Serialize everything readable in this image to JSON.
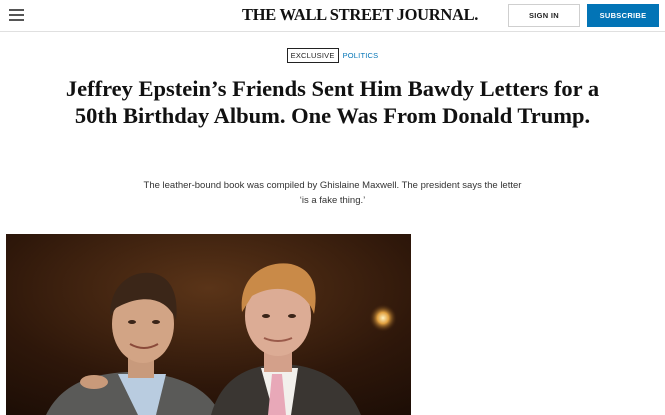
{
  "header": {
    "masthead": "THE WALL STREET JOURNAL.",
    "signin_label": "SIGN IN",
    "subscribe_label": "SUBSCRIBE",
    "subscribe_color": "#0274b6",
    "menu_icon": "hamburger-menu-icon"
  },
  "article": {
    "flag_exclusive": "EXCLUSIVE",
    "flag_section": "POLITICS",
    "headline": "Jeffrey Epstein’s Friends Sent Him Bawdy Letters for a 50th Birthday Album. One Was From Donald Trump.",
    "dek_line1": "The leather-bound book was compiled by Ghislaine Maxwell. The president says the letter",
    "dek_line2": "‘is a fake thing.’"
  }
}
